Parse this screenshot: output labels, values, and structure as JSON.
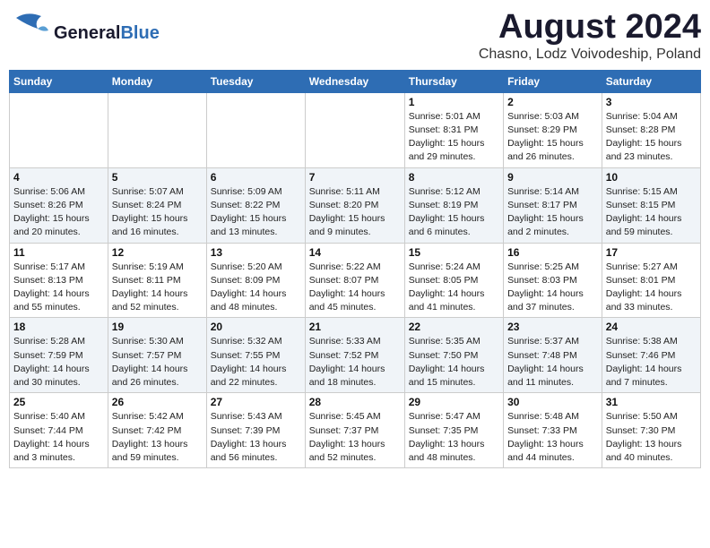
{
  "header": {
    "logo_general": "General",
    "logo_blue": "Blue",
    "main_title": "August 2024",
    "subtitle": "Chasno, Lodz Voivodeship, Poland"
  },
  "weekdays": [
    "Sunday",
    "Monday",
    "Tuesday",
    "Wednesday",
    "Thursday",
    "Friday",
    "Saturday"
  ],
  "weeks": [
    [
      {
        "day": "",
        "sunrise": "",
        "sunset": "",
        "daylight": ""
      },
      {
        "day": "",
        "sunrise": "",
        "sunset": "",
        "daylight": ""
      },
      {
        "day": "",
        "sunrise": "",
        "sunset": "",
        "daylight": ""
      },
      {
        "day": "",
        "sunrise": "",
        "sunset": "",
        "daylight": ""
      },
      {
        "day": "1",
        "sunrise": "Sunrise: 5:01 AM",
        "sunset": "Sunset: 8:31 PM",
        "daylight": "Daylight: 15 hours and 29 minutes."
      },
      {
        "day": "2",
        "sunrise": "Sunrise: 5:03 AM",
        "sunset": "Sunset: 8:29 PM",
        "daylight": "Daylight: 15 hours and 26 minutes."
      },
      {
        "day": "3",
        "sunrise": "Sunrise: 5:04 AM",
        "sunset": "Sunset: 8:28 PM",
        "daylight": "Daylight: 15 hours and 23 minutes."
      }
    ],
    [
      {
        "day": "4",
        "sunrise": "Sunrise: 5:06 AM",
        "sunset": "Sunset: 8:26 PM",
        "daylight": "Daylight: 15 hours and 20 minutes."
      },
      {
        "day": "5",
        "sunrise": "Sunrise: 5:07 AM",
        "sunset": "Sunset: 8:24 PM",
        "daylight": "Daylight: 15 hours and 16 minutes."
      },
      {
        "day": "6",
        "sunrise": "Sunrise: 5:09 AM",
        "sunset": "Sunset: 8:22 PM",
        "daylight": "Daylight: 15 hours and 13 minutes."
      },
      {
        "day": "7",
        "sunrise": "Sunrise: 5:11 AM",
        "sunset": "Sunset: 8:20 PM",
        "daylight": "Daylight: 15 hours and 9 minutes."
      },
      {
        "day": "8",
        "sunrise": "Sunrise: 5:12 AM",
        "sunset": "Sunset: 8:19 PM",
        "daylight": "Daylight: 15 hours and 6 minutes."
      },
      {
        "day": "9",
        "sunrise": "Sunrise: 5:14 AM",
        "sunset": "Sunset: 8:17 PM",
        "daylight": "Daylight: 15 hours and 2 minutes."
      },
      {
        "day": "10",
        "sunrise": "Sunrise: 5:15 AM",
        "sunset": "Sunset: 8:15 PM",
        "daylight": "Daylight: 14 hours and 59 minutes."
      }
    ],
    [
      {
        "day": "11",
        "sunrise": "Sunrise: 5:17 AM",
        "sunset": "Sunset: 8:13 PM",
        "daylight": "Daylight: 14 hours and 55 minutes."
      },
      {
        "day": "12",
        "sunrise": "Sunrise: 5:19 AM",
        "sunset": "Sunset: 8:11 PM",
        "daylight": "Daylight: 14 hours and 52 minutes."
      },
      {
        "day": "13",
        "sunrise": "Sunrise: 5:20 AM",
        "sunset": "Sunset: 8:09 PM",
        "daylight": "Daylight: 14 hours and 48 minutes."
      },
      {
        "day": "14",
        "sunrise": "Sunrise: 5:22 AM",
        "sunset": "Sunset: 8:07 PM",
        "daylight": "Daylight: 14 hours and 45 minutes."
      },
      {
        "day": "15",
        "sunrise": "Sunrise: 5:24 AM",
        "sunset": "Sunset: 8:05 PM",
        "daylight": "Daylight: 14 hours and 41 minutes."
      },
      {
        "day": "16",
        "sunrise": "Sunrise: 5:25 AM",
        "sunset": "Sunset: 8:03 PM",
        "daylight": "Daylight: 14 hours and 37 minutes."
      },
      {
        "day": "17",
        "sunrise": "Sunrise: 5:27 AM",
        "sunset": "Sunset: 8:01 PM",
        "daylight": "Daylight: 14 hours and 33 minutes."
      }
    ],
    [
      {
        "day": "18",
        "sunrise": "Sunrise: 5:28 AM",
        "sunset": "Sunset: 7:59 PM",
        "daylight": "Daylight: 14 hours and 30 minutes."
      },
      {
        "day": "19",
        "sunrise": "Sunrise: 5:30 AM",
        "sunset": "Sunset: 7:57 PM",
        "daylight": "Daylight: 14 hours and 26 minutes."
      },
      {
        "day": "20",
        "sunrise": "Sunrise: 5:32 AM",
        "sunset": "Sunset: 7:55 PM",
        "daylight": "Daylight: 14 hours and 22 minutes."
      },
      {
        "day": "21",
        "sunrise": "Sunrise: 5:33 AM",
        "sunset": "Sunset: 7:52 PM",
        "daylight": "Daylight: 14 hours and 18 minutes."
      },
      {
        "day": "22",
        "sunrise": "Sunrise: 5:35 AM",
        "sunset": "Sunset: 7:50 PM",
        "daylight": "Daylight: 14 hours and 15 minutes."
      },
      {
        "day": "23",
        "sunrise": "Sunrise: 5:37 AM",
        "sunset": "Sunset: 7:48 PM",
        "daylight": "Daylight: 14 hours and 11 minutes."
      },
      {
        "day": "24",
        "sunrise": "Sunrise: 5:38 AM",
        "sunset": "Sunset: 7:46 PM",
        "daylight": "Daylight: 14 hours and 7 minutes."
      }
    ],
    [
      {
        "day": "25",
        "sunrise": "Sunrise: 5:40 AM",
        "sunset": "Sunset: 7:44 PM",
        "daylight": "Daylight: 14 hours and 3 minutes."
      },
      {
        "day": "26",
        "sunrise": "Sunrise: 5:42 AM",
        "sunset": "Sunset: 7:42 PM",
        "daylight": "Daylight: 13 hours and 59 minutes."
      },
      {
        "day": "27",
        "sunrise": "Sunrise: 5:43 AM",
        "sunset": "Sunset: 7:39 PM",
        "daylight": "Daylight: 13 hours and 56 minutes."
      },
      {
        "day": "28",
        "sunrise": "Sunrise: 5:45 AM",
        "sunset": "Sunset: 7:37 PM",
        "daylight": "Daylight: 13 hours and 52 minutes."
      },
      {
        "day": "29",
        "sunrise": "Sunrise: 5:47 AM",
        "sunset": "Sunset: 7:35 PM",
        "daylight": "Daylight: 13 hours and 48 minutes."
      },
      {
        "day": "30",
        "sunrise": "Sunrise: 5:48 AM",
        "sunset": "Sunset: 7:33 PM",
        "daylight": "Daylight: 13 hours and 44 minutes."
      },
      {
        "day": "31",
        "sunrise": "Sunrise: 5:50 AM",
        "sunset": "Sunset: 7:30 PM",
        "daylight": "Daylight: 13 hours and 40 minutes."
      }
    ]
  ]
}
